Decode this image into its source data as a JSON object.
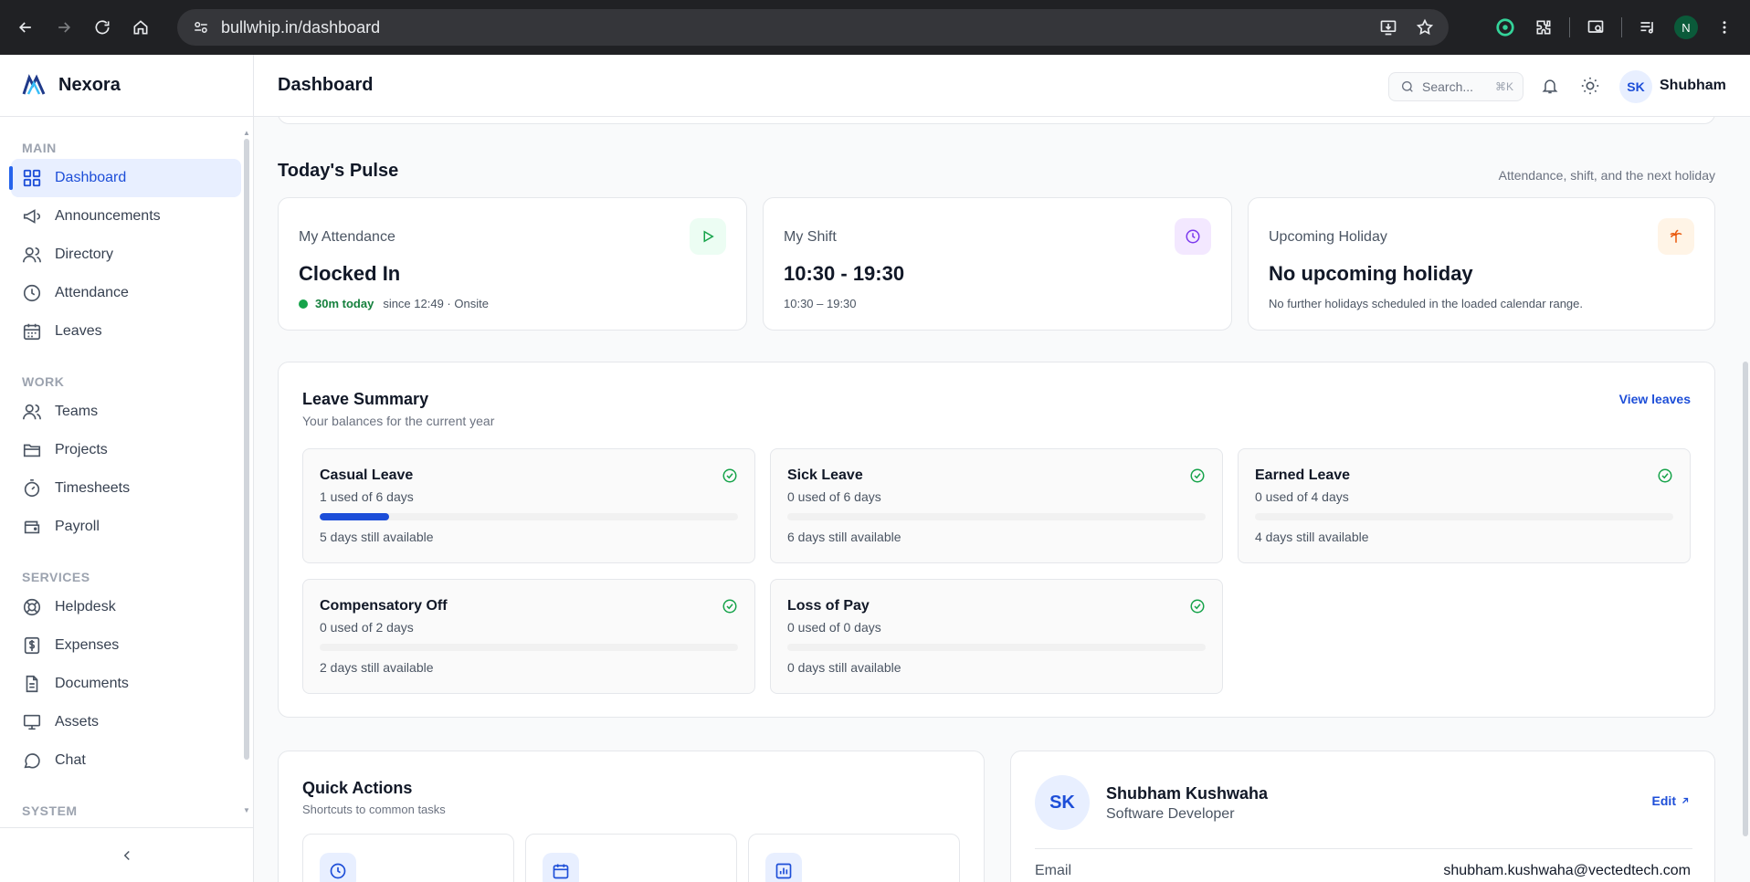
{
  "browser": {
    "url": "bullwhip.in/dashboard",
    "profile_initial": "N"
  },
  "brand": {
    "name": "Nexora"
  },
  "sidebar": {
    "sections": [
      {
        "label": "MAIN",
        "items": [
          {
            "label": "Dashboard",
            "icon": "grid-icon",
            "active": true
          },
          {
            "label": "Announcements",
            "icon": "megaphone-icon"
          },
          {
            "label": "Directory",
            "icon": "users-icon"
          },
          {
            "label": "Attendance",
            "icon": "clock-icon"
          },
          {
            "label": "Leaves",
            "icon": "calendar-icon"
          }
        ]
      },
      {
        "label": "WORK",
        "items": [
          {
            "label": "Teams",
            "icon": "users-icon"
          },
          {
            "label": "Projects",
            "icon": "folder-icon"
          },
          {
            "label": "Timesheets",
            "icon": "timer-icon"
          },
          {
            "label": "Payroll",
            "icon": "wallet-icon"
          }
        ]
      },
      {
        "label": "SERVICES",
        "items": [
          {
            "label": "Helpdesk",
            "icon": "lifebuoy-icon"
          },
          {
            "label": "Expenses",
            "icon": "dollar-icon"
          },
          {
            "label": "Documents",
            "icon": "document-icon"
          },
          {
            "label": "Assets",
            "icon": "monitor-icon"
          },
          {
            "label": "Chat",
            "icon": "chat-icon"
          }
        ]
      },
      {
        "label": "SYSTEM",
        "items": []
      }
    ]
  },
  "header": {
    "title": "Dashboard",
    "search_placeholder": "Search...",
    "search_shortcut": "⌘K",
    "user_initials": "SK",
    "user_name": "Shubham"
  },
  "pulse": {
    "title": "Today's Pulse",
    "subtitle": "Attendance, shift, and the next holiday",
    "attendance": {
      "label": "My Attendance",
      "value": "Clocked In",
      "duration": "30m today",
      "meta": "since 12:49 · Onsite"
    },
    "shift": {
      "label": "My Shift",
      "value": "10:30 - 19:30",
      "meta": "10:30 – 19:30"
    },
    "holiday": {
      "label": "Upcoming Holiday",
      "value": "No upcoming holiday",
      "meta": "No further holidays scheduled in the loaded calendar range."
    }
  },
  "leave_summary": {
    "title": "Leave Summary",
    "subtitle": "Your balances for the current year",
    "link": "View leaves",
    "items": [
      {
        "name": "Casual Leave",
        "used": "1 used of 6 days",
        "available": "5 days still available",
        "fraction": 0.1667
      },
      {
        "name": "Sick Leave",
        "used": "0 used of 6 days",
        "available": "6 days still available",
        "fraction": 0
      },
      {
        "name": "Earned Leave",
        "used": "0 used of 4 days",
        "available": "4 days still available",
        "fraction": 0
      },
      {
        "name": "Compensatory Off",
        "used": "0 used of 2 days",
        "available": "2 days still available",
        "fraction": 0
      },
      {
        "name": "Loss of Pay",
        "used": "0 used of 0 days",
        "available": "0 days still available",
        "fraction": 0
      }
    ]
  },
  "quick_actions": {
    "title": "Quick Actions",
    "subtitle": "Shortcuts to common tasks"
  },
  "profile": {
    "initials": "SK",
    "name": "Shubham Kushwaha",
    "role": "Software Developer",
    "edit_label": "Edit",
    "email_label": "Email",
    "email": "shubham.kushwaha@vectedtech.com"
  },
  "colors": {
    "accent": "#1d4ed8",
    "success": "#16a34a",
    "holiday": "#ea580c",
    "shift": "#7c3aed"
  }
}
